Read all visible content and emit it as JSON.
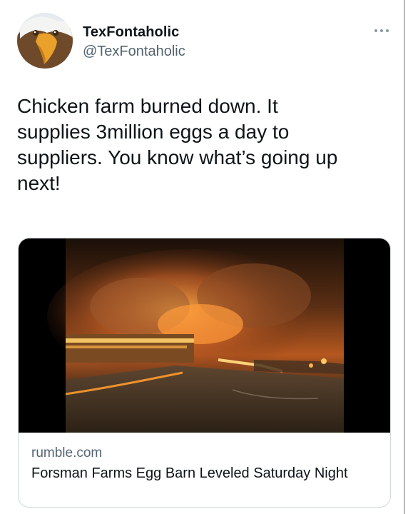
{
  "tweet": {
    "author": {
      "display_name": "TexFontaholic",
      "handle": "@TexFontaholic",
      "avatar_icon": "bald-eagle-icon"
    },
    "more_icon": "more-dots-icon",
    "text": "Chicken farm burned down. It\nsupplies 3million eggs a day to\nsuppliers. You know what’s going up\nnext!"
  },
  "link_card": {
    "image_icon": "burning-barn-photo",
    "domain": "rumble.com",
    "title": "Forsman Farms Egg Barn Leveled Saturday Night"
  },
  "colors": {
    "text_primary": "#0f1419",
    "text_secondary": "#536471",
    "card_border": "#cfd9de"
  }
}
